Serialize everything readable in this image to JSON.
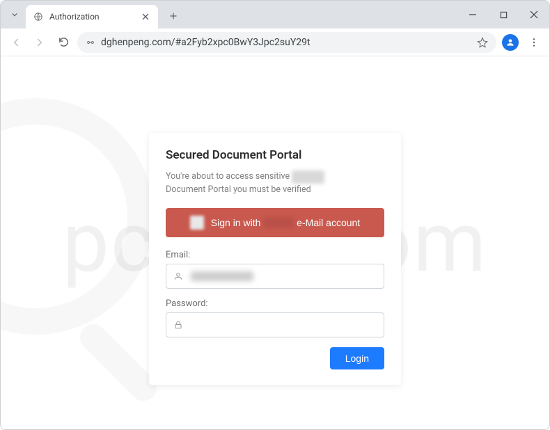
{
  "browser": {
    "tab_title": "Authorization",
    "url": "dghenpeng.com/#a2Fyb2xpc0BwY3Jpc2suY29t"
  },
  "watermark": "pcrisk.com",
  "card": {
    "title": "Secured Document Portal",
    "subtitle_line1_a": "You're about to access sensitive ",
    "subtitle_line1_blur": "xxxxx",
    "subtitle_line2": "Document Portal you must be verified",
    "signin_prefix": "Sign in with ",
    "signin_blur": "xxxx",
    "signin_suffix": " e-Mail account",
    "email_label": "Email:",
    "password_label": "Password:",
    "login_label": "Login"
  }
}
